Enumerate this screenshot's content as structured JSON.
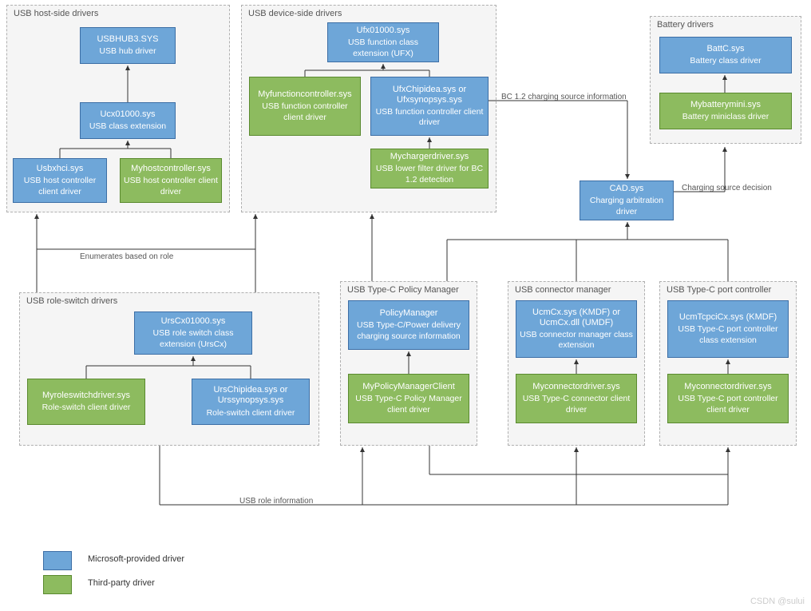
{
  "groups": {
    "hostSide": "USB host-side drivers",
    "deviceSide": "USB device-side drivers",
    "battery": "Battery drivers",
    "roleSwitch": "USB role-switch drivers",
    "policyMgr": "USB Type-C  Policy Manager",
    "connMgr": "USB connector manager",
    "portCtrl": "USB Type-C port controller"
  },
  "boxes": {
    "usbhub3": {
      "t": "USBHUB3.SYS",
      "s": "USB hub driver"
    },
    "ucx01000": {
      "t": "Ucx01000.sys",
      "s": "USB class extension"
    },
    "usbxhci": {
      "t": "Usbxhci.sys",
      "s": "USB host controller client driver"
    },
    "myhostctrl": {
      "t": "Myhostcontroller.sys",
      "s": "USB host controller client driver"
    },
    "ufx01000": {
      "t": "Ufx01000.sys",
      "s": "USB function class extension (UFX)"
    },
    "myfuncctrl": {
      "t": "Myfunctioncontroller.sys",
      "s": "USB function controller client driver"
    },
    "ufxchip": {
      "t": "UfxChipidea.sys or Ufxsynopsys.sys",
      "s": "USB function controller client driver"
    },
    "mycharger": {
      "t": "Mychargerdriver.sys",
      "s": "USB lower filter driver for BC 1.2 detection"
    },
    "battc": {
      "t": "BattC.sys",
      "s": "Battery class driver"
    },
    "mybattmini": {
      "t": "Mybatterymini.sys",
      "s": "Battery miniclass driver"
    },
    "cad": {
      "t": "CAD.sys",
      "s": "Charging arbitration driver"
    },
    "urscx": {
      "t": "UrsCx01000.sys",
      "s": "USB role switch class extension (UrsCx)"
    },
    "myroleswitch": {
      "t": "Myroleswitchdriver.sys",
      "s": "Role-switch client driver"
    },
    "urschip": {
      "t": "UrsChipidea.sys or Urssynopsys.sys",
      "s": "Role-switch client driver"
    },
    "policymgr": {
      "t": "PolicyManager",
      "s": "USB Type-C/Power delivery charging source information"
    },
    "mypolicy": {
      "t": "MyPolicyManagerClient",
      "s": "USB Type-C Policy Manager client driver"
    },
    "ucmcx": {
      "t": "UcmCx.sys (KMDF) or UcmCx.dll (UMDF)",
      "s": "USB connector manager class extension"
    },
    "myconn": {
      "t": "Myconnectordriver.sys",
      "s": "USB Type-C connector client driver"
    },
    "ucmtcpci": {
      "t": "UcmTcpciCx.sys (KMDF)",
      "s": "USB Type-C port controller class extension"
    },
    "myconn2": {
      "t": "Myconnectordriver.sys",
      "s": "USB Type-C port controller client driver"
    }
  },
  "edgeLabels": {
    "bc12": "BC 1.2 charging source information",
    "chargingDecision": "Charging source decision",
    "enumRole": "Enumerates based on role",
    "usbRoleInfo": "USB role information"
  },
  "legend": {
    "ms": "Microsoft-provided driver",
    "tp": "Third-party driver"
  },
  "watermark": "CSDN @sului"
}
